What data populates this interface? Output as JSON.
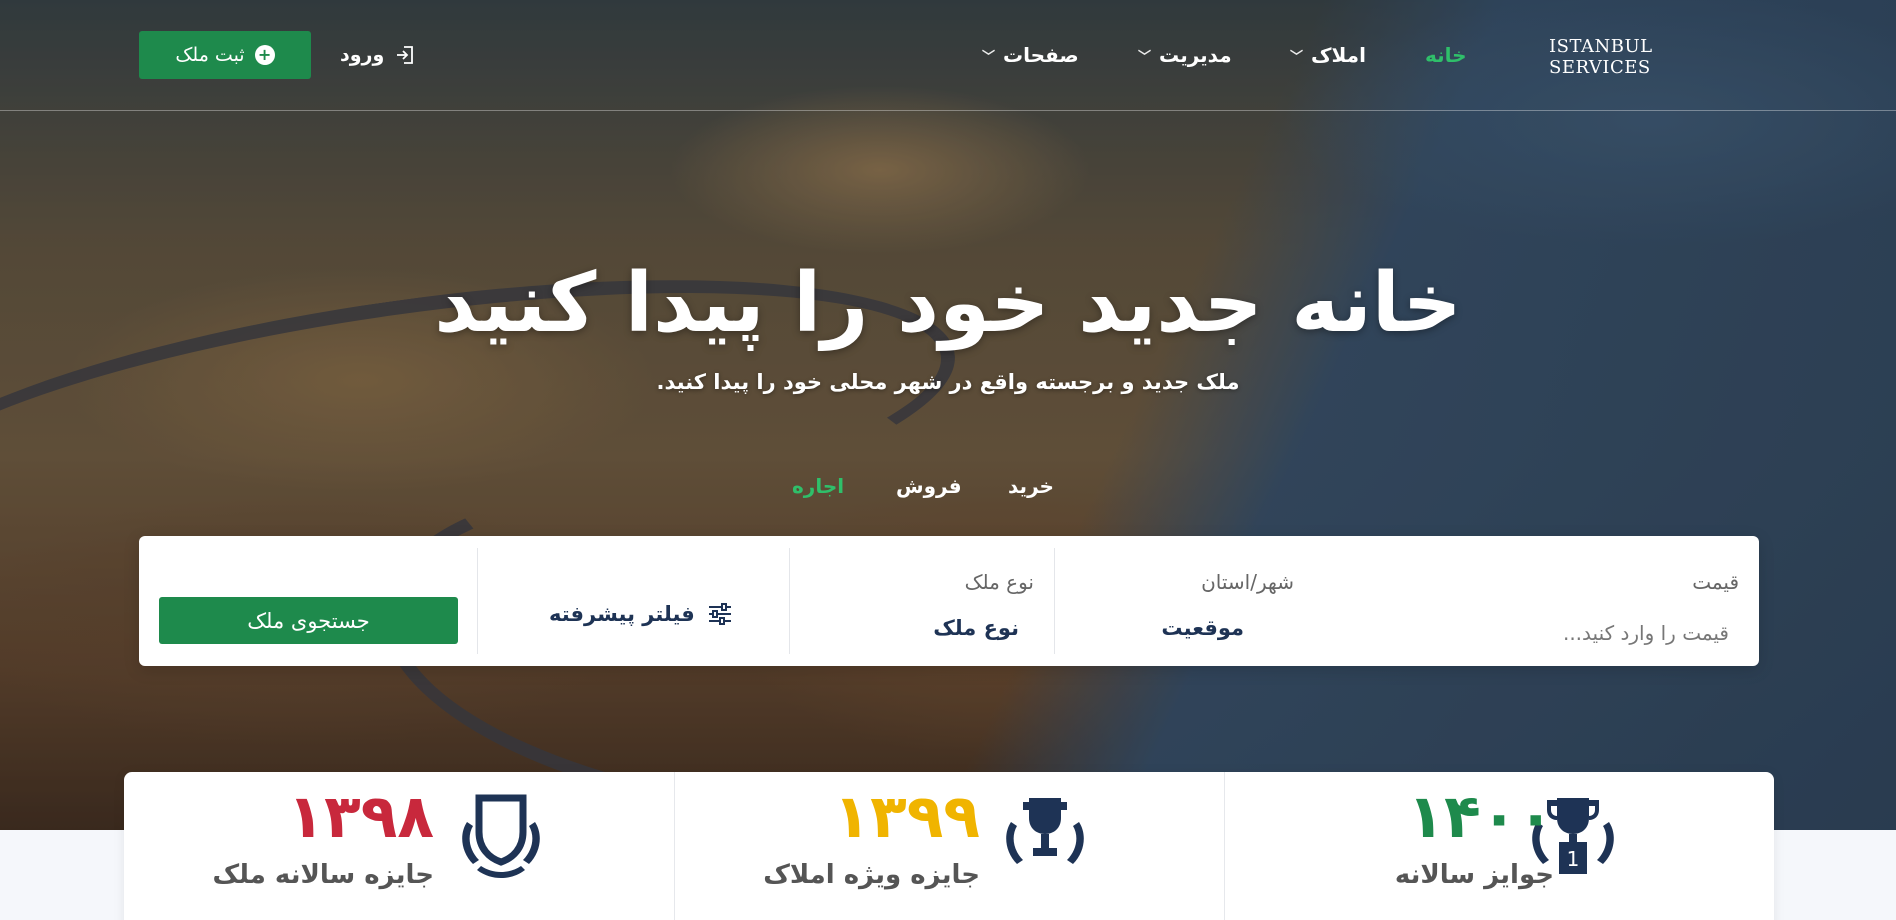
{
  "header": {
    "brand": "ISTANBUL SERVICES",
    "nav": [
      {
        "label": "خانه",
        "active": true,
        "has_dropdown": false
      },
      {
        "label": "املاک",
        "active": false,
        "has_dropdown": true
      },
      {
        "label": "مدیریت",
        "active": false,
        "has_dropdown": true
      },
      {
        "label": "صفحات",
        "active": false,
        "has_dropdown": true
      }
    ],
    "login_label": "ورود",
    "add_property_label": "ثبت ملک"
  },
  "hero": {
    "title": "خانه جدید خود را پیدا کنید",
    "subtitle": "ملک جدید و برجسته واقع در شهر محلی خود را پیدا کنید."
  },
  "tabs": [
    {
      "label": "خرید",
      "active": false
    },
    {
      "label": "فروش",
      "active": false
    },
    {
      "label": "اجاره",
      "active": true
    }
  ],
  "search": {
    "price_label": "قیمت",
    "price_placeholder": "قیمت را وارد کنید...",
    "city_label": "شهر/استان",
    "city_value": "موقعیت",
    "type_label": "نوع ملک",
    "type_value": "نوع ملک",
    "advanced_filter": "فیلتر پیشرفته",
    "search_button": "جستجوی ملک"
  },
  "awards": [
    {
      "year": "۱۴۰۰",
      "name": "جوایز سالانه",
      "color": "#1e8a4c",
      "icon": "trophy-first-icon"
    },
    {
      "year": "۱۳۹۹",
      "name": "جایزه ویژه املاک",
      "color": "#f0b400",
      "icon": "trophy-laurel-icon"
    },
    {
      "year": "۱۳۹۸",
      "name": "جایزه سالانه ملک",
      "color": "#c8283c",
      "icon": "shield-laurel-icon"
    }
  ],
  "colors": {
    "accent": "#1e8a4c",
    "accent_light": "#2fbf6a",
    "navy": "#1e3355"
  }
}
